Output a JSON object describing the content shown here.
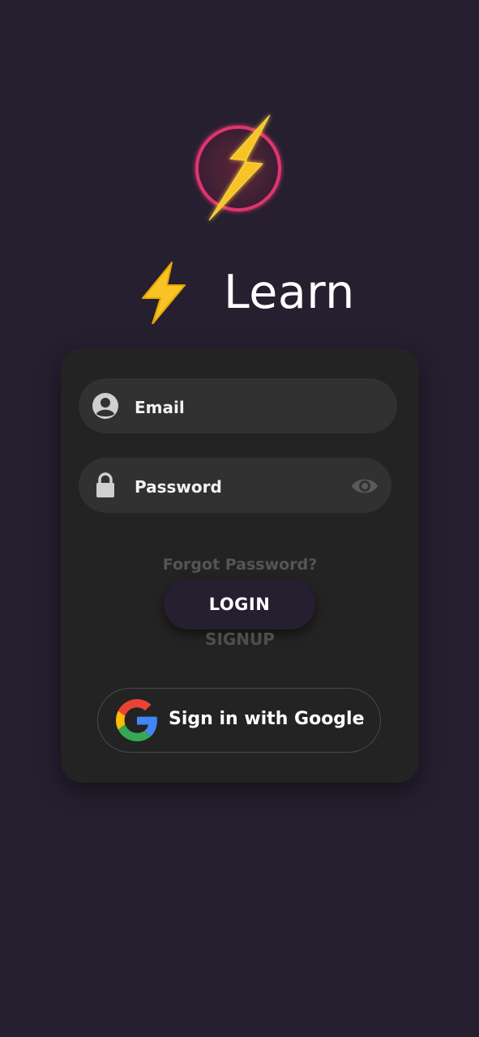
{
  "app": {
    "title": "Learn",
    "logo_icon": "lightning-bolt-logo",
    "title_icon": "high-voltage-emoji"
  },
  "form": {
    "email": {
      "placeholder": "Email",
      "icon": "user-icon"
    },
    "password": {
      "placeholder": "Password",
      "icon": "lock-icon",
      "toggle_icon": "eye-icon"
    },
    "forgot_label": "Forgot Password?",
    "login_label": "LOGIN",
    "signup_label": "SIGNUP",
    "google_label": "Sign in with Google"
  },
  "colors": {
    "background": "#251f30",
    "card": "#232323",
    "field": "#313131",
    "logo_ring": "#e0356d",
    "bolt": "#f7c325"
  }
}
